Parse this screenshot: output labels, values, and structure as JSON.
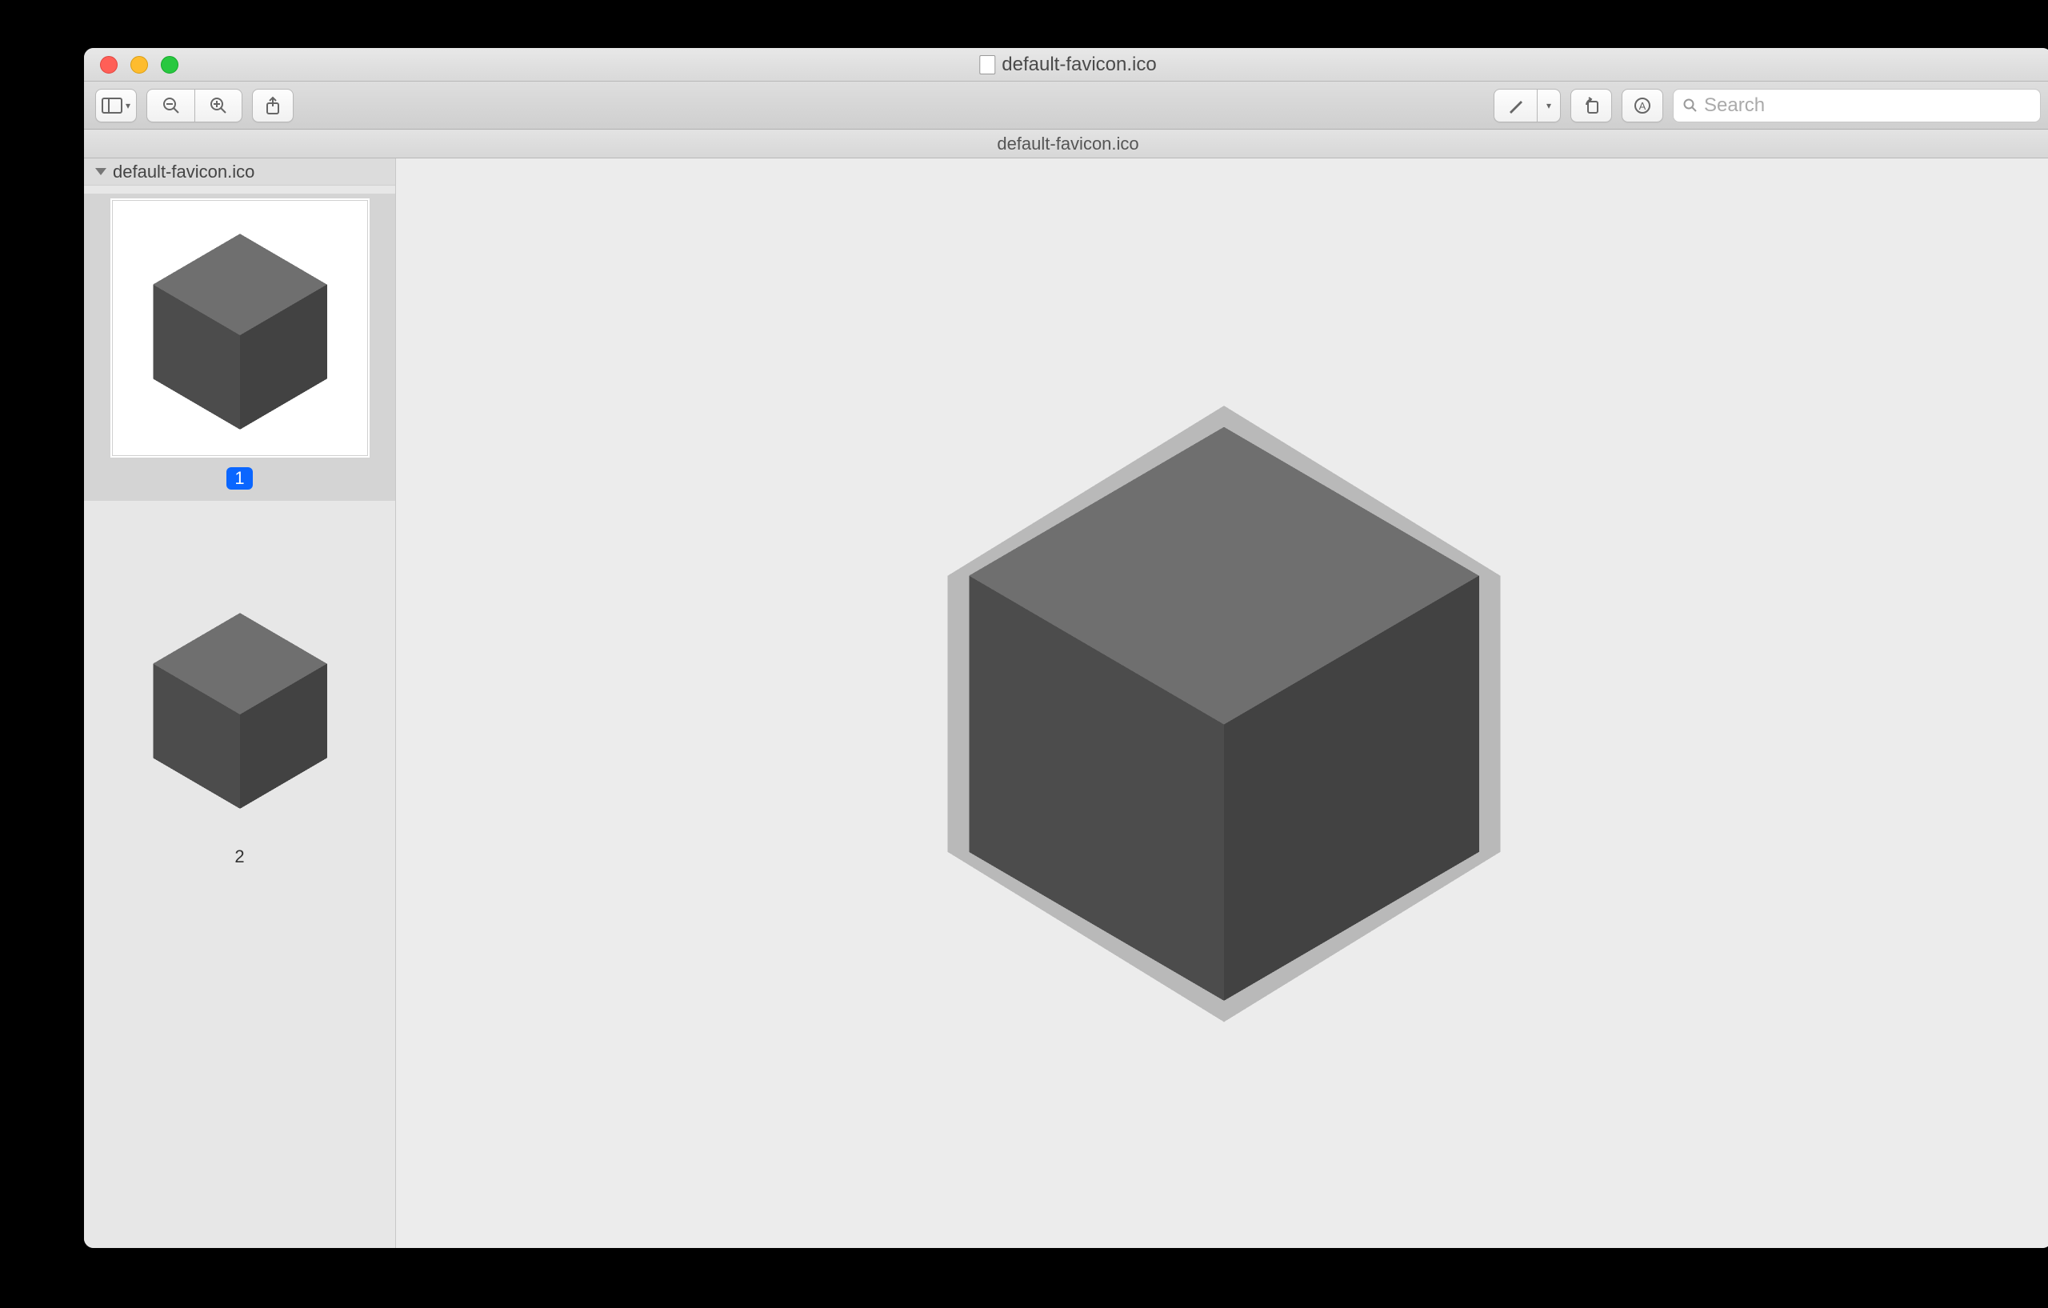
{
  "window": {
    "title": "default-favicon.ico",
    "subtitle": "default-favicon.ico"
  },
  "toolbar": {
    "search_placeholder": "Search"
  },
  "sidebar": {
    "file_label": "default-favicon.ico",
    "thumbs": [
      {
        "label": "1",
        "selected": true
      },
      {
        "label": "2",
        "selected": false
      }
    ]
  },
  "icons": {
    "sidebar_toggle": "sidebar-toggle-icon",
    "zoom_out": "zoom-out-icon",
    "zoom_in": "zoom-in-icon",
    "share": "share-icon",
    "markup": "markup-icon",
    "rotate": "rotate-icon",
    "info": "info-icon",
    "search": "search-icon"
  },
  "colors": {
    "cube_top": "#6f6f6f",
    "cube_left": "#4c4c4c",
    "cube_right": "#424242",
    "selection": "#0a66ff"
  }
}
